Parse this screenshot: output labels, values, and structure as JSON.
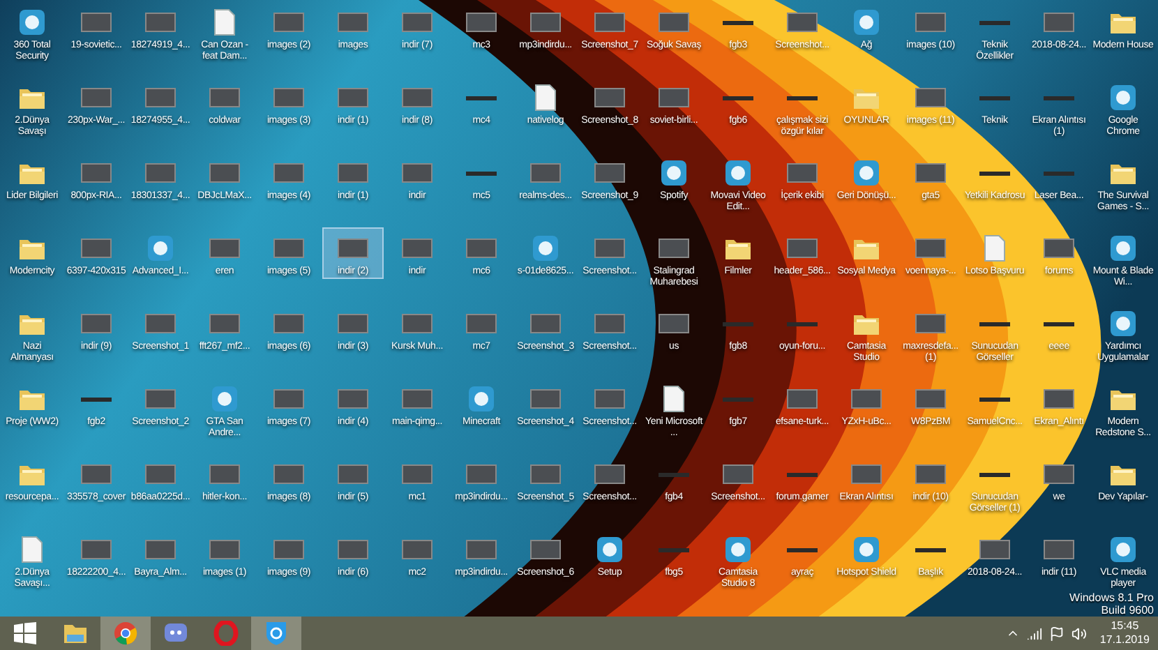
{
  "icons": [
    {
      "label": "360 Total Security",
      "kind": "app",
      "selected": false
    },
    {
      "label": "2.Dünya Savaşı",
      "kind": "folder",
      "selected": false
    },
    {
      "label": "Lider Bilgileri",
      "kind": "folder",
      "selected": false
    },
    {
      "label": "Moderncity",
      "kind": "folder",
      "selected": false
    },
    {
      "label": "Nazi Almanyası",
      "kind": "folder",
      "selected": false
    },
    {
      "label": "Proje (WW2)",
      "kind": "folder",
      "selected": false
    },
    {
      "label": "resourcepa...",
      "kind": "folder",
      "selected": false
    },
    {
      "label": "2.Dünya Savaşı...",
      "kind": "document",
      "selected": false
    },
    {
      "label": "19-sovietic...",
      "kind": "image",
      "selected": false
    },
    {
      "label": "230px-War_...",
      "kind": "image",
      "selected": false
    },
    {
      "label": "800px-RIA...",
      "kind": "image",
      "selected": false
    },
    {
      "label": "6397-420x315",
      "kind": "image",
      "selected": false
    },
    {
      "label": "indir (9)",
      "kind": "image",
      "selected": false
    },
    {
      "label": "fgb2",
      "kind": "strip",
      "selected": false
    },
    {
      "label": "335578_cover",
      "kind": "image",
      "selected": false
    },
    {
      "label": "18222200_4...",
      "kind": "image",
      "selected": false
    },
    {
      "label": "18274919_4...",
      "kind": "image",
      "selected": false
    },
    {
      "label": "18274955_4...",
      "kind": "image",
      "selected": false
    },
    {
      "label": "18301337_4...",
      "kind": "image",
      "selected": false
    },
    {
      "label": "Advanced_I...",
      "kind": "app",
      "selected": false
    },
    {
      "label": "Screenshot_1",
      "kind": "image",
      "selected": false
    },
    {
      "label": "Screenshot_2",
      "kind": "image",
      "selected": false
    },
    {
      "label": "b86aa0225d...",
      "kind": "image",
      "selected": false
    },
    {
      "label": "Bayra_Alm...",
      "kind": "image",
      "selected": false
    },
    {
      "label": "Can Ozan - feat Dam...",
      "kind": "document",
      "selected": false
    },
    {
      "label": "coldwar",
      "kind": "image",
      "selected": false
    },
    {
      "label": "DBJcLMaX...",
      "kind": "image",
      "selected": false
    },
    {
      "label": "eren",
      "kind": "image",
      "selected": false
    },
    {
      "label": "fft267_mf2...",
      "kind": "image",
      "selected": false
    },
    {
      "label": "GTA San Andre...",
      "kind": "app",
      "selected": false
    },
    {
      "label": "hitler-kon...",
      "kind": "image",
      "selected": false
    },
    {
      "label": "images (1)",
      "kind": "image",
      "selected": false
    },
    {
      "label": "images (2)",
      "kind": "image",
      "selected": false
    },
    {
      "label": "images (3)",
      "kind": "image",
      "selected": false
    },
    {
      "label": "images (4)",
      "kind": "image",
      "selected": false
    },
    {
      "label": "images (5)",
      "kind": "image",
      "selected": false
    },
    {
      "label": "images (6)",
      "kind": "image",
      "selected": false
    },
    {
      "label": "images (7)",
      "kind": "image",
      "selected": false
    },
    {
      "label": "images (8)",
      "kind": "image",
      "selected": false
    },
    {
      "label": "images (9)",
      "kind": "image",
      "selected": false
    },
    {
      "label": "images",
      "kind": "image",
      "selected": false
    },
    {
      "label": "indir (1)",
      "kind": "image",
      "selected": false
    },
    {
      "label": "indir (1)",
      "kind": "image",
      "selected": false
    },
    {
      "label": "indir (2)",
      "kind": "image",
      "selected": true
    },
    {
      "label": "indir (3)",
      "kind": "image",
      "selected": false
    },
    {
      "label": "indir (4)",
      "kind": "image",
      "selected": false
    },
    {
      "label": "indir (5)",
      "kind": "image",
      "selected": false
    },
    {
      "label": "indir (6)",
      "kind": "image",
      "selected": false
    },
    {
      "label": "indir (7)",
      "kind": "image",
      "selected": false
    },
    {
      "label": "indir (8)",
      "kind": "image",
      "selected": false
    },
    {
      "label": "indir",
      "kind": "image",
      "selected": false
    },
    {
      "label": "indir",
      "kind": "image",
      "selected": false
    },
    {
      "label": "Kursk Muh...",
      "kind": "image",
      "selected": false
    },
    {
      "label": "main-qimg...",
      "kind": "image",
      "selected": false
    },
    {
      "label": "mc1",
      "kind": "image",
      "selected": false
    },
    {
      "label": "mc2",
      "kind": "image",
      "selected": false
    },
    {
      "label": "mc3",
      "kind": "image",
      "selected": false
    },
    {
      "label": "mc4",
      "kind": "strip",
      "selected": false
    },
    {
      "label": "mc5",
      "kind": "strip",
      "selected": false
    },
    {
      "label": "mc6",
      "kind": "image",
      "selected": false
    },
    {
      "label": "mc7",
      "kind": "image",
      "selected": false
    },
    {
      "label": "Minecraft",
      "kind": "app",
      "selected": false
    },
    {
      "label": "mp3indirdu...",
      "kind": "image",
      "selected": false
    },
    {
      "label": "mp3indirdu...",
      "kind": "image",
      "selected": false
    },
    {
      "label": "mp3indirdu...",
      "kind": "image",
      "selected": false
    },
    {
      "label": "nativelog",
      "kind": "document",
      "selected": false
    },
    {
      "label": "realms-des...",
      "kind": "image",
      "selected": false
    },
    {
      "label": "s-01de8625...",
      "kind": "app",
      "selected": false
    },
    {
      "label": "Screenshot_3",
      "kind": "image",
      "selected": false
    },
    {
      "label": "Screenshot_4",
      "kind": "image",
      "selected": false
    },
    {
      "label": "Screenshot_5",
      "kind": "image",
      "selected": false
    },
    {
      "label": "Screenshot_6",
      "kind": "image",
      "selected": false
    },
    {
      "label": "Screenshot_7",
      "kind": "image",
      "selected": false
    },
    {
      "label": "Screenshot_8",
      "kind": "image",
      "selected": false
    },
    {
      "label": "Screenshot_9",
      "kind": "image",
      "selected": false
    },
    {
      "label": "Screenshot...",
      "kind": "image",
      "selected": false
    },
    {
      "label": "Screenshot...",
      "kind": "image",
      "selected": false
    },
    {
      "label": "Screenshot...",
      "kind": "image",
      "selected": false
    },
    {
      "label": "Screenshot...",
      "kind": "image",
      "selected": false
    },
    {
      "label": "Setup",
      "kind": "app",
      "selected": false
    },
    {
      "label": "Soğuk Savaş",
      "kind": "image",
      "selected": false
    },
    {
      "label": "soviet-birli...",
      "kind": "image",
      "selected": false
    },
    {
      "label": "Spotify",
      "kind": "app",
      "selected": false
    },
    {
      "label": "Stalingrad Muharebesi",
      "kind": "image",
      "selected": false
    },
    {
      "label": "us",
      "kind": "image",
      "selected": false
    },
    {
      "label": "Yeni Microsoft ...",
      "kind": "document",
      "selected": false
    },
    {
      "label": "fgb4",
      "kind": "strip",
      "selected": false
    },
    {
      "label": "fbg5",
      "kind": "strip",
      "selected": false
    },
    {
      "label": "fgb3",
      "kind": "strip",
      "selected": false
    },
    {
      "label": "fgb6",
      "kind": "strip",
      "selected": false
    },
    {
      "label": "Movavi Video Edit...",
      "kind": "app",
      "selected": false
    },
    {
      "label": "Filmler",
      "kind": "folder",
      "selected": false
    },
    {
      "label": "fgb8",
      "kind": "strip",
      "selected": false
    },
    {
      "label": "fgb7",
      "kind": "strip",
      "selected": false
    },
    {
      "label": "Screenshot...",
      "kind": "image",
      "selected": false
    },
    {
      "label": "Camtasia Studio 8",
      "kind": "app",
      "selected": false
    },
    {
      "label": "Screenshot...",
      "kind": "image",
      "selected": false
    },
    {
      "label": "çalışmak sizi özgür kılar",
      "kind": "strip",
      "selected": false
    },
    {
      "label": "İçerik ekibi",
      "kind": "image",
      "selected": false
    },
    {
      "label": "header_586...",
      "kind": "image",
      "selected": false
    },
    {
      "label": "oyun-foru...",
      "kind": "strip",
      "selected": false
    },
    {
      "label": "efsane-turk...",
      "kind": "image",
      "selected": false
    },
    {
      "label": "forum.gamer",
      "kind": "strip",
      "selected": false
    },
    {
      "label": "ayraç",
      "kind": "strip",
      "selected": false
    },
    {
      "label": "Ağ",
      "kind": "app",
      "selected": false
    },
    {
      "label": "OYUNLAR",
      "kind": "folder",
      "selected": false
    },
    {
      "label": "Geri Dönüşü...",
      "kind": "app",
      "selected": false
    },
    {
      "label": "Sosyal Medya",
      "kind": "folder",
      "selected": false
    },
    {
      "label": "Camtasia Studio",
      "kind": "folder",
      "selected": false
    },
    {
      "label": "YZxH-uBc...",
      "kind": "image",
      "selected": false
    },
    {
      "label": "Ekran Alıntısı",
      "kind": "image",
      "selected": false
    },
    {
      "label": "Hotspot Shield",
      "kind": "app",
      "selected": false
    },
    {
      "label": "images (10)",
      "kind": "image",
      "selected": false
    },
    {
      "label": "images (11)",
      "kind": "image",
      "selected": false
    },
    {
      "label": "gta5",
      "kind": "image",
      "selected": false
    },
    {
      "label": "voennaya-...",
      "kind": "image",
      "selected": false
    },
    {
      "label": "maxresdefa... (1)",
      "kind": "image",
      "selected": false
    },
    {
      "label": "W8PzBM",
      "kind": "image",
      "selected": false
    },
    {
      "label": "indir (10)",
      "kind": "image",
      "selected": false
    },
    {
      "label": "Başlık",
      "kind": "strip",
      "selected": false
    },
    {
      "label": "Teknik Özellikler",
      "kind": "strip",
      "selected": false
    },
    {
      "label": "Teknik",
      "kind": "strip",
      "selected": false
    },
    {
      "label": "Yetkili Kadrosu",
      "kind": "strip",
      "selected": false
    },
    {
      "label": "Lotso Başvuru",
      "kind": "document",
      "selected": false
    },
    {
      "label": "Sunucudan Görseller",
      "kind": "strip",
      "selected": false
    },
    {
      "label": "SamuelCnc...",
      "kind": "strip",
      "selected": false
    },
    {
      "label": "Sunucudan Görseller (1)",
      "kind": "strip",
      "selected": false
    },
    {
      "label": "2018-08-24...",
      "kind": "image",
      "selected": false
    },
    {
      "label": "2018-08-24...",
      "kind": "image",
      "selected": false
    },
    {
      "label": "Ekran Alıntısı (1)",
      "kind": "strip",
      "selected": false
    },
    {
      "label": "Laser Bea...",
      "kind": "strip",
      "selected": false
    },
    {
      "label": "forums",
      "kind": "image",
      "selected": false
    },
    {
      "label": "eeee",
      "kind": "strip",
      "selected": false
    },
    {
      "label": "Ekran_Alıntı",
      "kind": "image",
      "selected": false
    },
    {
      "label": "we",
      "kind": "image",
      "selected": false
    },
    {
      "label": "indir (11)",
      "kind": "image",
      "selected": false
    },
    {
      "label": "Modern House",
      "kind": "folder",
      "selected": false
    },
    {
      "label": "Google Chrome",
      "kind": "app",
      "selected": false
    },
    {
      "label": "The Survival Games - S...",
      "kind": "folder",
      "selected": false
    },
    {
      "label": "Mount & Blade Wi...",
      "kind": "app",
      "selected": false
    },
    {
      "label": "Yardımcı Uygulamalar",
      "kind": "app",
      "selected": false
    },
    {
      "label": "Modern Redstone S...",
      "kind": "folder",
      "selected": false
    },
    {
      "label": "Dev Yapılar-",
      "kind": "folder",
      "selected": false
    },
    {
      "label": "VLC media player",
      "kind": "app",
      "selected": false
    }
  ],
  "os_watermark": [
    "Windows 8.1 Pro",
    "Build 9600"
  ],
  "taskbar": {
    "items": [
      {
        "kind": "start",
        "selected": false
      },
      {
        "kind": "explorer",
        "selected": false
      },
      {
        "kind": "chrome",
        "selected": true
      },
      {
        "kind": "chat",
        "selected": false
      },
      {
        "kind": "opera",
        "selected": false
      },
      {
        "kind": "shield",
        "selected": true
      }
    ],
    "time": "15:45",
    "date": "17.1.2019"
  }
}
